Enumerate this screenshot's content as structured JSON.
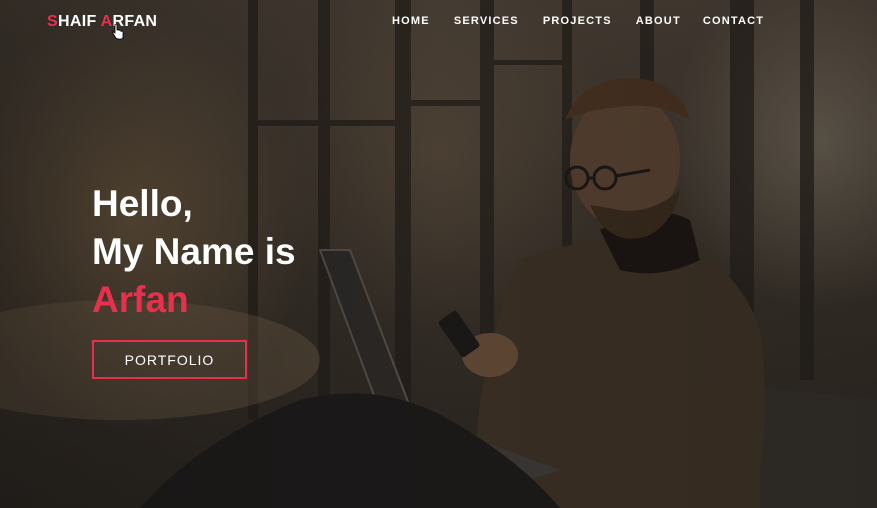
{
  "brand": {
    "first_initial": "S",
    "first_rest": "HAIF ",
    "last_initial": "A",
    "last_rest": "RFAN"
  },
  "nav": {
    "items": [
      {
        "label": "HOME"
      },
      {
        "label": "SERVICES"
      },
      {
        "label": "PROJECTS"
      },
      {
        "label": "ABOUT"
      },
      {
        "label": "CONTACT"
      }
    ]
  },
  "hero": {
    "line1": "Hello,",
    "line2": "My Name is",
    "name": "Arfan",
    "button_label": "PORTFOLIO"
  },
  "colors": {
    "accent": "#e8304c",
    "text": "#ffffff"
  },
  "icons": {
    "cursor": "hand-pointer-icon"
  }
}
